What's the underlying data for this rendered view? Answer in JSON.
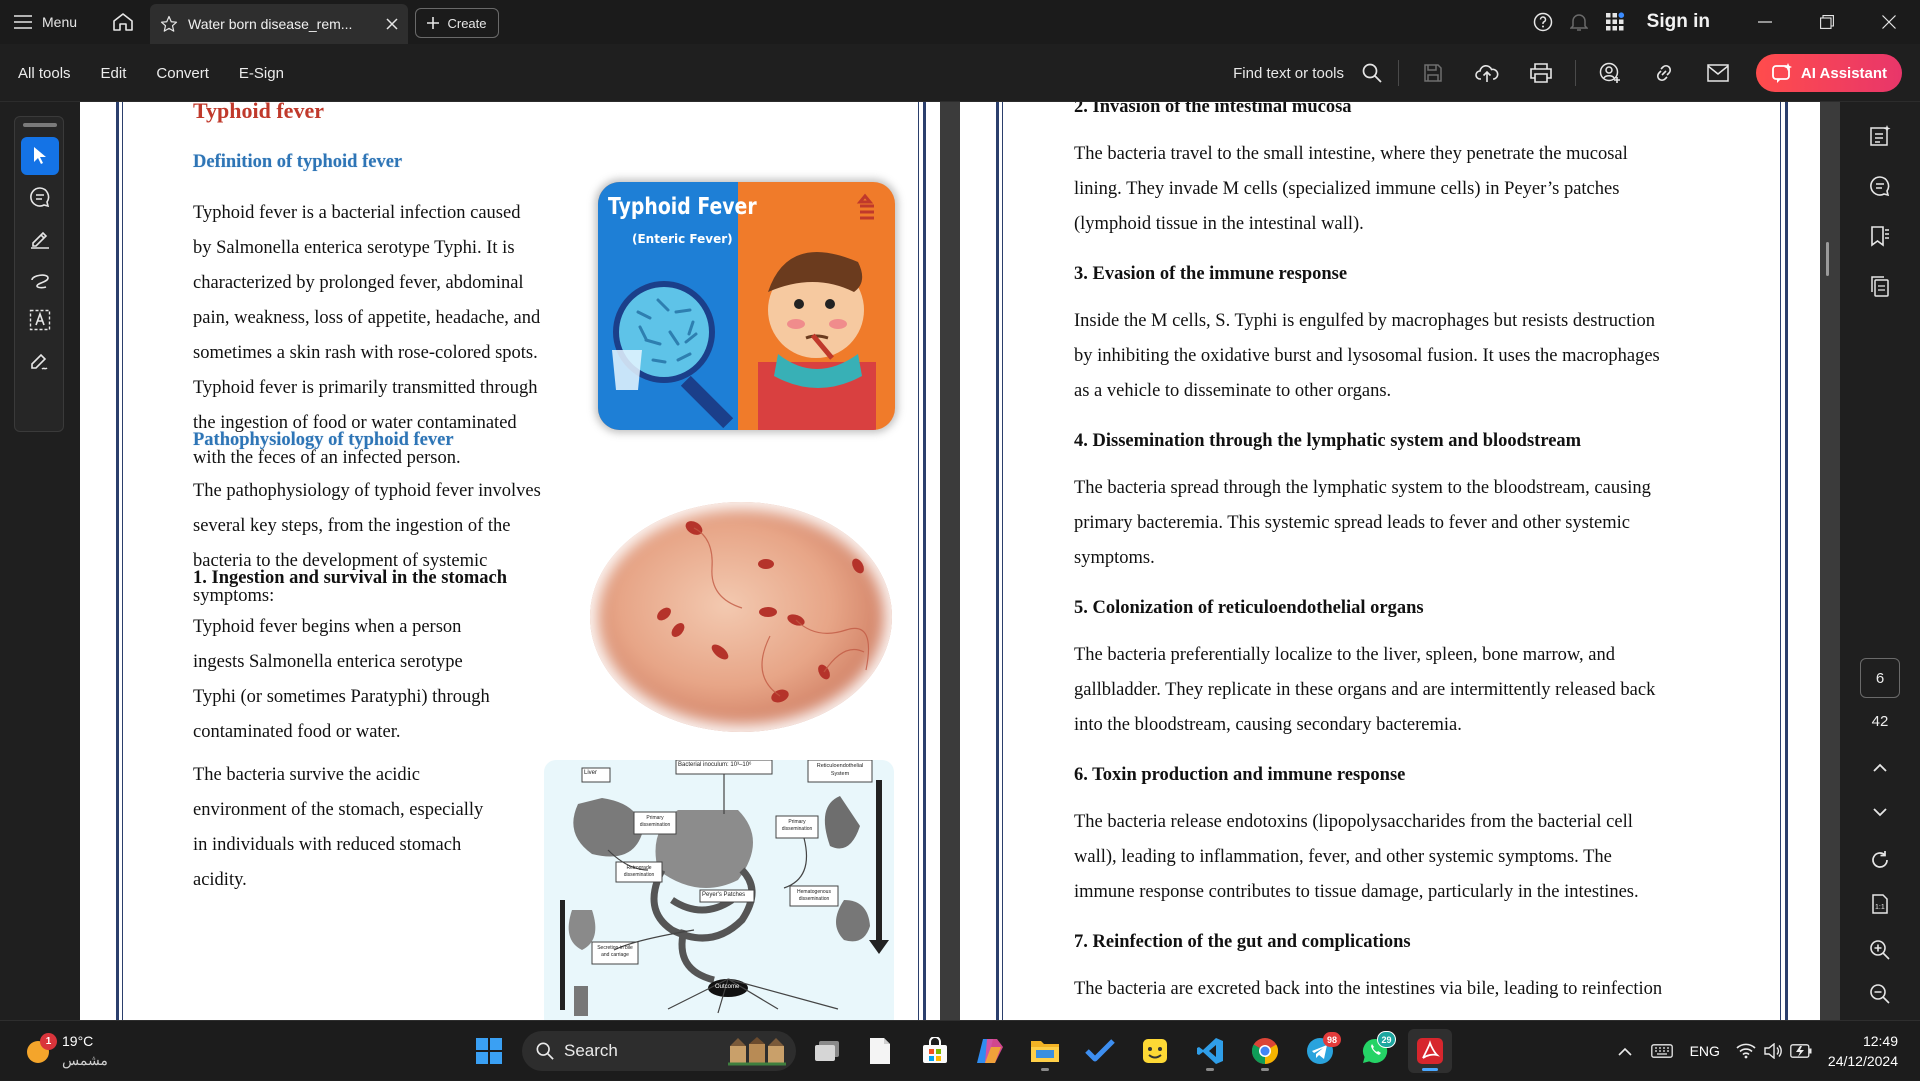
{
  "titlebar": {
    "menu_label": "Menu",
    "tab_title": "Water born disease_rem...",
    "create_label": "Create",
    "sign_in": "Sign in"
  },
  "toolbar": {
    "menu": [
      "All tools",
      "Edit",
      "Convert",
      "E-Sign"
    ],
    "find_label": "Find text or tools",
    "ai_label": "AI Assistant",
    "accent": "#ff4c4c"
  },
  "page_left": {
    "title": "Typhoid fever",
    "def_heading": "Definition of typhoid fever",
    "def_lines": [
      "Typhoid fever is a bacterial infection caused",
      "by Salmonella enterica serotype Typhi. It is",
      "characterized by prolonged fever, abdominal",
      "pain, weakness, loss of appetite, headache, and",
      "sometimes a skin rash with rose-colored spots.",
      "Typhoid fever is primarily transmitted through",
      "the ingestion of food or water contaminated",
      "with the feces of an infected person."
    ],
    "patho_heading": "Pathophysiology of typhoid fever",
    "patho_lines": [
      "The pathophysiology of typhoid fever involves",
      "several key steps, from the ingestion of the",
      "bacteria to the development of systemic",
      "symptoms:"
    ],
    "step1_heading": "1. Ingestion and survival in the stomach",
    "step1_p1": [
      "Typhoid fever begins when a person",
      "ingests Salmonella enterica serotype",
      "Typhi (or sometimes Paratyphi) through",
      "contaminated food or water."
    ],
    "step1_p2": [
      "The bacteria survive the acidic",
      "environment of the stomach, especially",
      "in individuals with reduced stomach",
      "acidity."
    ],
    "poster_title": "Typhoid Fever",
    "poster_subtitle": "(Enteric Fever)",
    "diagram_labels": {
      "liver": "Liver",
      "inoculum": "Bacterial inoculum: 10³–10⁶",
      "res": "Reticuloendothelial System",
      "primary": "Primary dissemination",
      "primary2": "Primary dissemination",
      "retrograde": "Retrograde dissemination",
      "peyers": "Peyer's Patches",
      "hematogenous": "Hematogenous dissemination",
      "secretion": "Secretion in bile and carriage",
      "outcome": "Outcome"
    }
  },
  "page_right": {
    "sections": [
      {
        "heading": "2. Invasion of the intestinal mucosa",
        "lines": [
          "The bacteria travel to the small intestine, where they penetrate the mucosal",
          "lining. They invade M cells (specialized immune cells) in Peyer’s patches",
          "(lymphoid tissue in the intestinal wall)."
        ]
      },
      {
        "heading": "3. Evasion of the immune response",
        "lines": [
          "Inside the M cells, S. Typhi is engulfed by macrophages but resists destruction",
          "by inhibiting the oxidative burst and lysosomal fusion. It uses the macrophages",
          "as a vehicle to disseminate to other organs."
        ]
      },
      {
        "heading": "4. Dissemination through the lymphatic system and bloodstream",
        "lines": [
          "The bacteria spread through the lymphatic system to the bloodstream, causing",
          "primary bacteremia. This systemic spread leads to fever and other systemic",
          "symptoms."
        ]
      },
      {
        "heading": "5. Colonization of reticuloendothelial organs",
        "lines": [
          "The bacteria preferentially localize to the liver, spleen, bone marrow, and",
          "gallbladder. They replicate in these organs and are intermittently released back",
          "into the bloodstream, causing secondary bacteremia."
        ]
      },
      {
        "heading": "6. Toxin production and immune response",
        "lines": [
          "The bacteria release endotoxins (lipopolysaccharides from the bacterial cell",
          "wall), leading to inflammation, fever, and other systemic symptoms. The",
          "immune response contributes to tissue damage, particularly in the intestines."
        ]
      },
      {
        "heading": "7. Reinfection of the gut and complications",
        "lines": [
          "The bacteria are excreted back into the intestines via bile, leading to reinfection"
        ]
      }
    ]
  },
  "rightrail": {
    "current_page": "6",
    "total_pages": "42"
  },
  "taskbar": {
    "weather_temp": "19°C",
    "weather_desc": "مشمس",
    "weather_badge": "1",
    "search_label": "Search",
    "telegram_badge": "98",
    "whatsapp_badge": "29",
    "lang": "ENG",
    "time": "12:49",
    "date": "24/12/2024"
  }
}
